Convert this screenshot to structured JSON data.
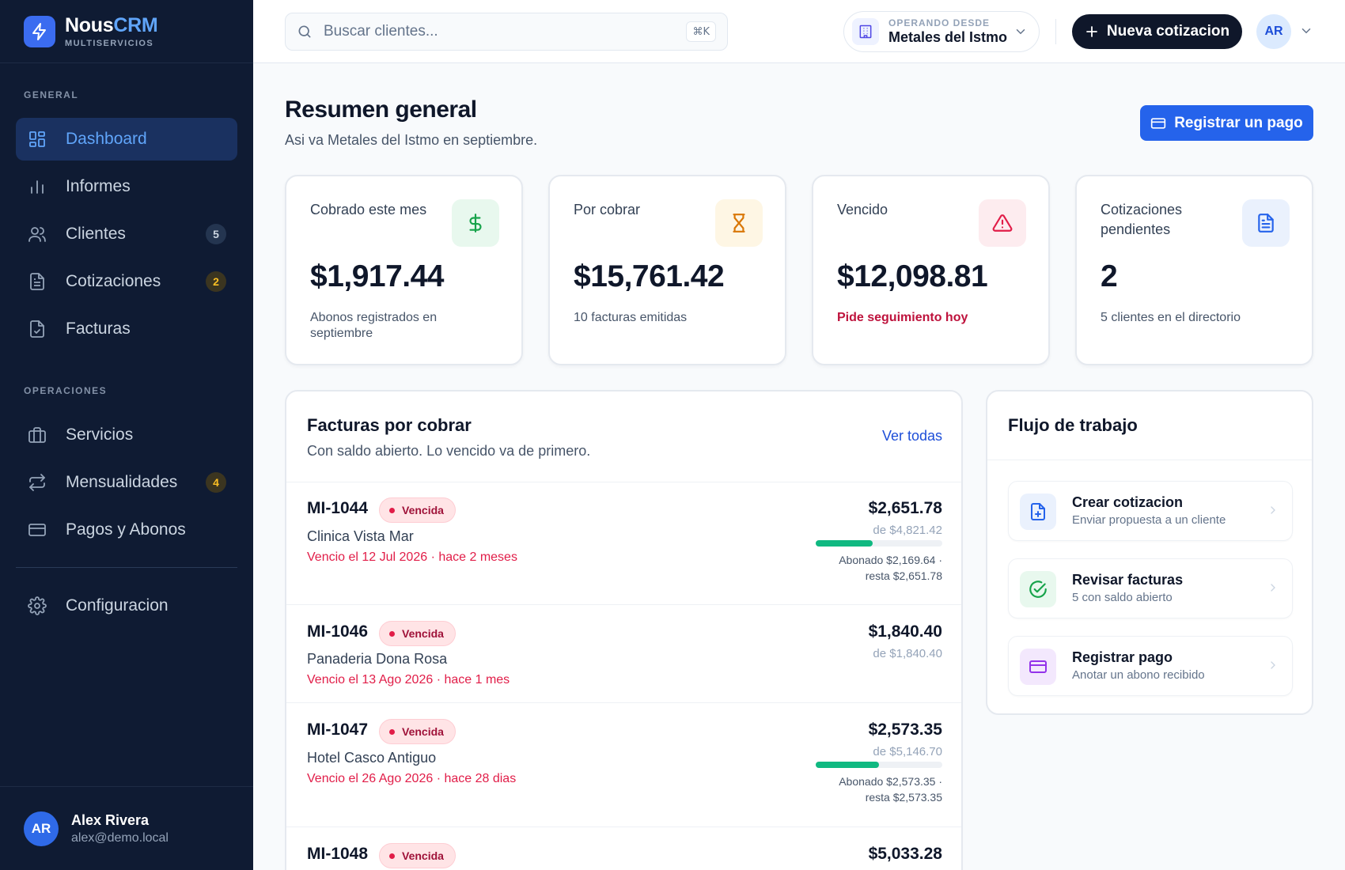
{
  "brand": {
    "name_part1": "Nous",
    "name_part2": "CRM",
    "subtitle": "MULTISERVICIOS"
  },
  "sidebar": {
    "section_general": "GENERAL",
    "section_operaciones": "OPERACIONES",
    "items": [
      {
        "label": "Dashboard",
        "icon": "dashboard-icon",
        "active": true
      },
      {
        "label": "Informes",
        "icon": "bar-chart-icon"
      },
      {
        "label": "Clientes",
        "icon": "users-icon",
        "badge": "5"
      },
      {
        "label": "Cotizaciones",
        "icon": "document-icon",
        "badge": "2"
      },
      {
        "label": "Facturas",
        "icon": "invoice-check-icon"
      },
      {
        "label": "Servicios",
        "icon": "briefcase-icon"
      },
      {
        "label": "Mensualidades",
        "icon": "repeat-icon",
        "badge": "4"
      },
      {
        "label": "Pagos y Abonos",
        "icon": "credit-card-icon"
      },
      {
        "label": "Configuracion",
        "icon": "gear-icon"
      }
    ],
    "user": {
      "initials": "AR",
      "name": "Alex Rivera",
      "email": "alex@demo.local"
    }
  },
  "topbar": {
    "search_placeholder": "Buscar clientes...",
    "shortcut": "⌘K",
    "company_label": "OPERANDO DESDE",
    "company_name": "Metales del Istmo",
    "new_quote_label": "Nueva cotizacion",
    "avatar_initials": "AR"
  },
  "header": {
    "title": "Resumen general",
    "subtitle": "Asi va Metales del Istmo en septiembre.",
    "pay_button": "Registrar un pago"
  },
  "kpis": [
    {
      "label": "Cobrado este mes",
      "value": "$1,917.44",
      "note": "Abonos registrados en septiembre",
      "icon": "dollar-icon",
      "color": "#16a34a"
    },
    {
      "label": "Por cobrar",
      "value": "$15,761.42",
      "note": "10 facturas emitidas",
      "icon": "hourglass-icon",
      "color": "#d97706"
    },
    {
      "label": "Vencido",
      "value": "$12,098.81",
      "note": "Pide seguimiento hoy",
      "icon": "warning-icon",
      "color": "#e11d48"
    },
    {
      "label": "Cotizaciones pendientes",
      "value": "2",
      "note": "5 clientes en el directorio",
      "icon": "document-icon",
      "color": "#2563eb"
    }
  ],
  "invoices": {
    "title": "Facturas por cobrar",
    "subtitle": "Con saldo abierto. Lo vencido va de primero.",
    "see_all": "Ver todas",
    "rows": [
      {
        "code": "MI-1044",
        "status": "Vencida",
        "client": "Clinica Vista Mar",
        "due": "Vencio el 12 Jul 2026 · hace 2 meses",
        "amount": "$2,651.78",
        "total": "de $4,821.42",
        "progress": 0.45,
        "paid_line1": "Abonado $2,169.64 ·",
        "paid_line2": "resta $2,651.78"
      },
      {
        "code": "MI-1046",
        "status": "Vencida",
        "client": "Panaderia Dona Rosa",
        "due": "Vencio el 13 Ago 2026 · hace 1 mes",
        "amount": "$1,840.40",
        "total": "de $1,840.40"
      },
      {
        "code": "MI-1047",
        "status": "Vencida",
        "client": "Hotel Casco Antiguo",
        "due": "Vencio el 26 Ago 2026 · hace 28 dias",
        "amount": "$2,573.35",
        "total": "de $5,146.70",
        "progress": 0.5,
        "paid_line1": "Abonado $2,573.35 ·",
        "paid_line2": "resta $2,573.35"
      },
      {
        "code": "MI-1048",
        "status": "Vencida",
        "amount": "$5,033.28"
      }
    ]
  },
  "workflow": {
    "title": "Flujo de trabajo",
    "items": [
      {
        "title": "Crear cotizacion",
        "desc": "Enviar propuesta a un cliente",
        "icon": "file-plus-icon"
      },
      {
        "title": "Revisar facturas",
        "desc": "5 con saldo abierto",
        "icon": "check-circle-icon"
      },
      {
        "title": "Registrar pago",
        "desc": "Anotar un abono recibido",
        "icon": "credit-card-icon"
      }
    ]
  }
}
